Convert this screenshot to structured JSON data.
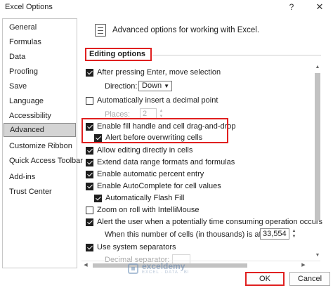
{
  "window": {
    "title": "Excel Options",
    "help_glyph": "?",
    "close_glyph": "✕"
  },
  "sidebar": {
    "items": [
      {
        "label": "General"
      },
      {
        "label": "Formulas"
      },
      {
        "label": "Data"
      },
      {
        "label": "Proofing"
      },
      {
        "label": "Save"
      },
      {
        "label": "Language"
      },
      {
        "label": "Accessibility"
      },
      {
        "label": "Advanced",
        "active": true
      },
      {
        "label": "Customize Ribbon"
      },
      {
        "label": "Quick Access Toolbar"
      },
      {
        "label": "Add-ins"
      },
      {
        "label": "Trust Center"
      }
    ]
  },
  "main": {
    "header_title": "Advanced options for working with Excel.",
    "section_title": "Editing options",
    "options": {
      "after_enter": {
        "label": "After pressing Enter, move selection",
        "checked": true
      },
      "direction": {
        "label": "Direction:",
        "value": "Down"
      },
      "auto_decimal": {
        "label": "Automatically insert a decimal point",
        "checked": false
      },
      "places": {
        "label": "Places:",
        "value": "2"
      },
      "fill_handle": {
        "label": "Enable fill handle and cell drag-and-drop",
        "checked": true
      },
      "alert_overwrite": {
        "label": "Alert before overwriting cells",
        "checked": true
      },
      "edit_in_cells": {
        "label": "Allow editing directly in cells",
        "checked": true
      },
      "extend_formats": {
        "label": "Extend data range formats and formulas",
        "checked": true
      },
      "percent_entry": {
        "label": "Enable automatic percent entry",
        "checked": true
      },
      "autocomplete": {
        "label": "Enable AutoComplete for cell values",
        "checked": true
      },
      "flash_fill": {
        "label": "Automatically Flash Fill",
        "checked": true
      },
      "zoom_roll": {
        "label": "Zoom on roll with IntelliMouse",
        "checked": false
      },
      "alert_time": {
        "label": "Alert the user when a potentially time consuming operation occurs",
        "checked": true
      },
      "cells_affected": {
        "label": "When this number of cells (in thousands) is affected:",
        "value": "33,554"
      },
      "system_separators": {
        "label": "Use system separators",
        "checked": true
      },
      "decimal_separator": {
        "label": "Decimal separator:",
        "value": ""
      }
    }
  },
  "watermark": {
    "name": "exceldemy",
    "tagline": "EXCEL · DATA · BI"
  },
  "buttons": {
    "ok": "OK",
    "cancel": "Cancel"
  },
  "colors": {
    "highlight": "#e02020",
    "active_item": "#d4d4d4"
  }
}
